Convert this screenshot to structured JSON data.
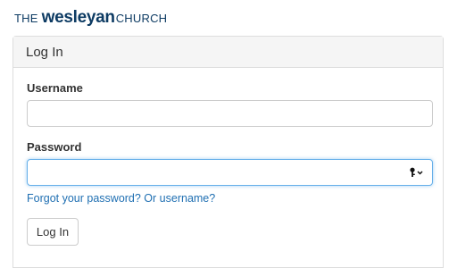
{
  "brand": {
    "prefix": "THE",
    "name": "wesleyan",
    "suffix": "CHURCH",
    "color": "#0d3b63"
  },
  "panel": {
    "title": "Log In"
  },
  "form": {
    "username_label": "Username",
    "username_value": "",
    "password_label": "Password",
    "password_value": "",
    "password_manager_icon": "key-dropdown-icon",
    "forgot_link": "Forgot your password? Or username?",
    "submit_label": "Log In",
    "focus_color": "#66afe9",
    "link_color": "#1f6fb2"
  }
}
